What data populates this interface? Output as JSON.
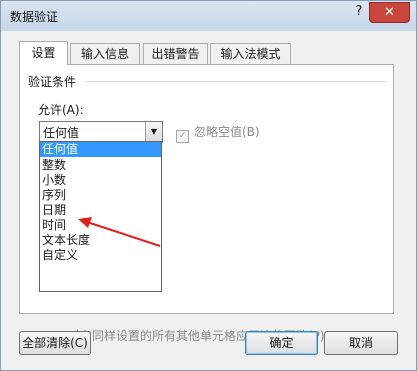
{
  "window": {
    "title": "数据验证",
    "help": "?",
    "close": "✕"
  },
  "tabs": [
    {
      "label": "设置"
    },
    {
      "label": "输入信息"
    },
    {
      "label": "出错警告"
    },
    {
      "label": "输入法模式"
    }
  ],
  "validation": {
    "group_title": "验证条件",
    "allow_label": "允许(A):",
    "allow_value": "任何值",
    "ignore_blank": "忽略空值(B)",
    "options": [
      "任何值",
      "整数",
      "小数",
      "序列",
      "日期",
      "时间",
      "文本长度",
      "自定义"
    ],
    "selected_option": "任何值"
  },
  "apply_all": "对有同样设置的所有其他单元格应用这些更改(P)",
  "buttons": {
    "clear_all": "全部清除(C)",
    "ok": "确定",
    "cancel": "取消"
  },
  "annotation": {
    "arrow_color": "#e0201a",
    "points_to": "序列"
  }
}
